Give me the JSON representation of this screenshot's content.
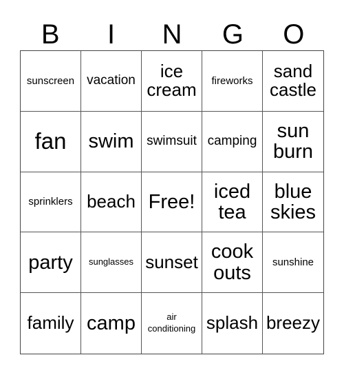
{
  "header": [
    "B",
    "I",
    "N",
    "G",
    "O"
  ],
  "rows": [
    [
      {
        "text": "sunscreen",
        "size": "s-sm"
      },
      {
        "text": "vacation",
        "size": "s-md"
      },
      {
        "text": "ice cream",
        "size": "s-lg"
      },
      {
        "text": "fireworks",
        "size": "s-sm"
      },
      {
        "text": "sand castle",
        "size": "s-lg"
      }
    ],
    [
      {
        "text": "fan",
        "size": "s-xxl"
      },
      {
        "text": "swim",
        "size": "s-xl"
      },
      {
        "text": "swimsuit",
        "size": "s-md"
      },
      {
        "text": "camping",
        "size": "s-md"
      },
      {
        "text": "sun burn",
        "size": "s-xl"
      }
    ],
    [
      {
        "text": "sprinklers",
        "size": "s-sm"
      },
      {
        "text": "beach",
        "size": "s-lg"
      },
      {
        "text": "Free!",
        "size": "s-xl"
      },
      {
        "text": "iced tea",
        "size": "s-xl"
      },
      {
        "text": "blue skies",
        "size": "s-xl"
      }
    ],
    [
      {
        "text": "party",
        "size": "s-xl"
      },
      {
        "text": "sunglasses",
        "size": "s-xs"
      },
      {
        "text": "sunset",
        "size": "s-lg"
      },
      {
        "text": "cook outs",
        "size": "s-xl"
      },
      {
        "text": "sunshine",
        "size": "s-sm"
      }
    ],
    [
      {
        "text": "family",
        "size": "s-lg"
      },
      {
        "text": "camp",
        "size": "s-xl"
      },
      {
        "text": "air conditioning",
        "size": "s-xs"
      },
      {
        "text": "splash",
        "size": "s-lg"
      },
      {
        "text": "breezy",
        "size": "s-lg"
      }
    ]
  ]
}
